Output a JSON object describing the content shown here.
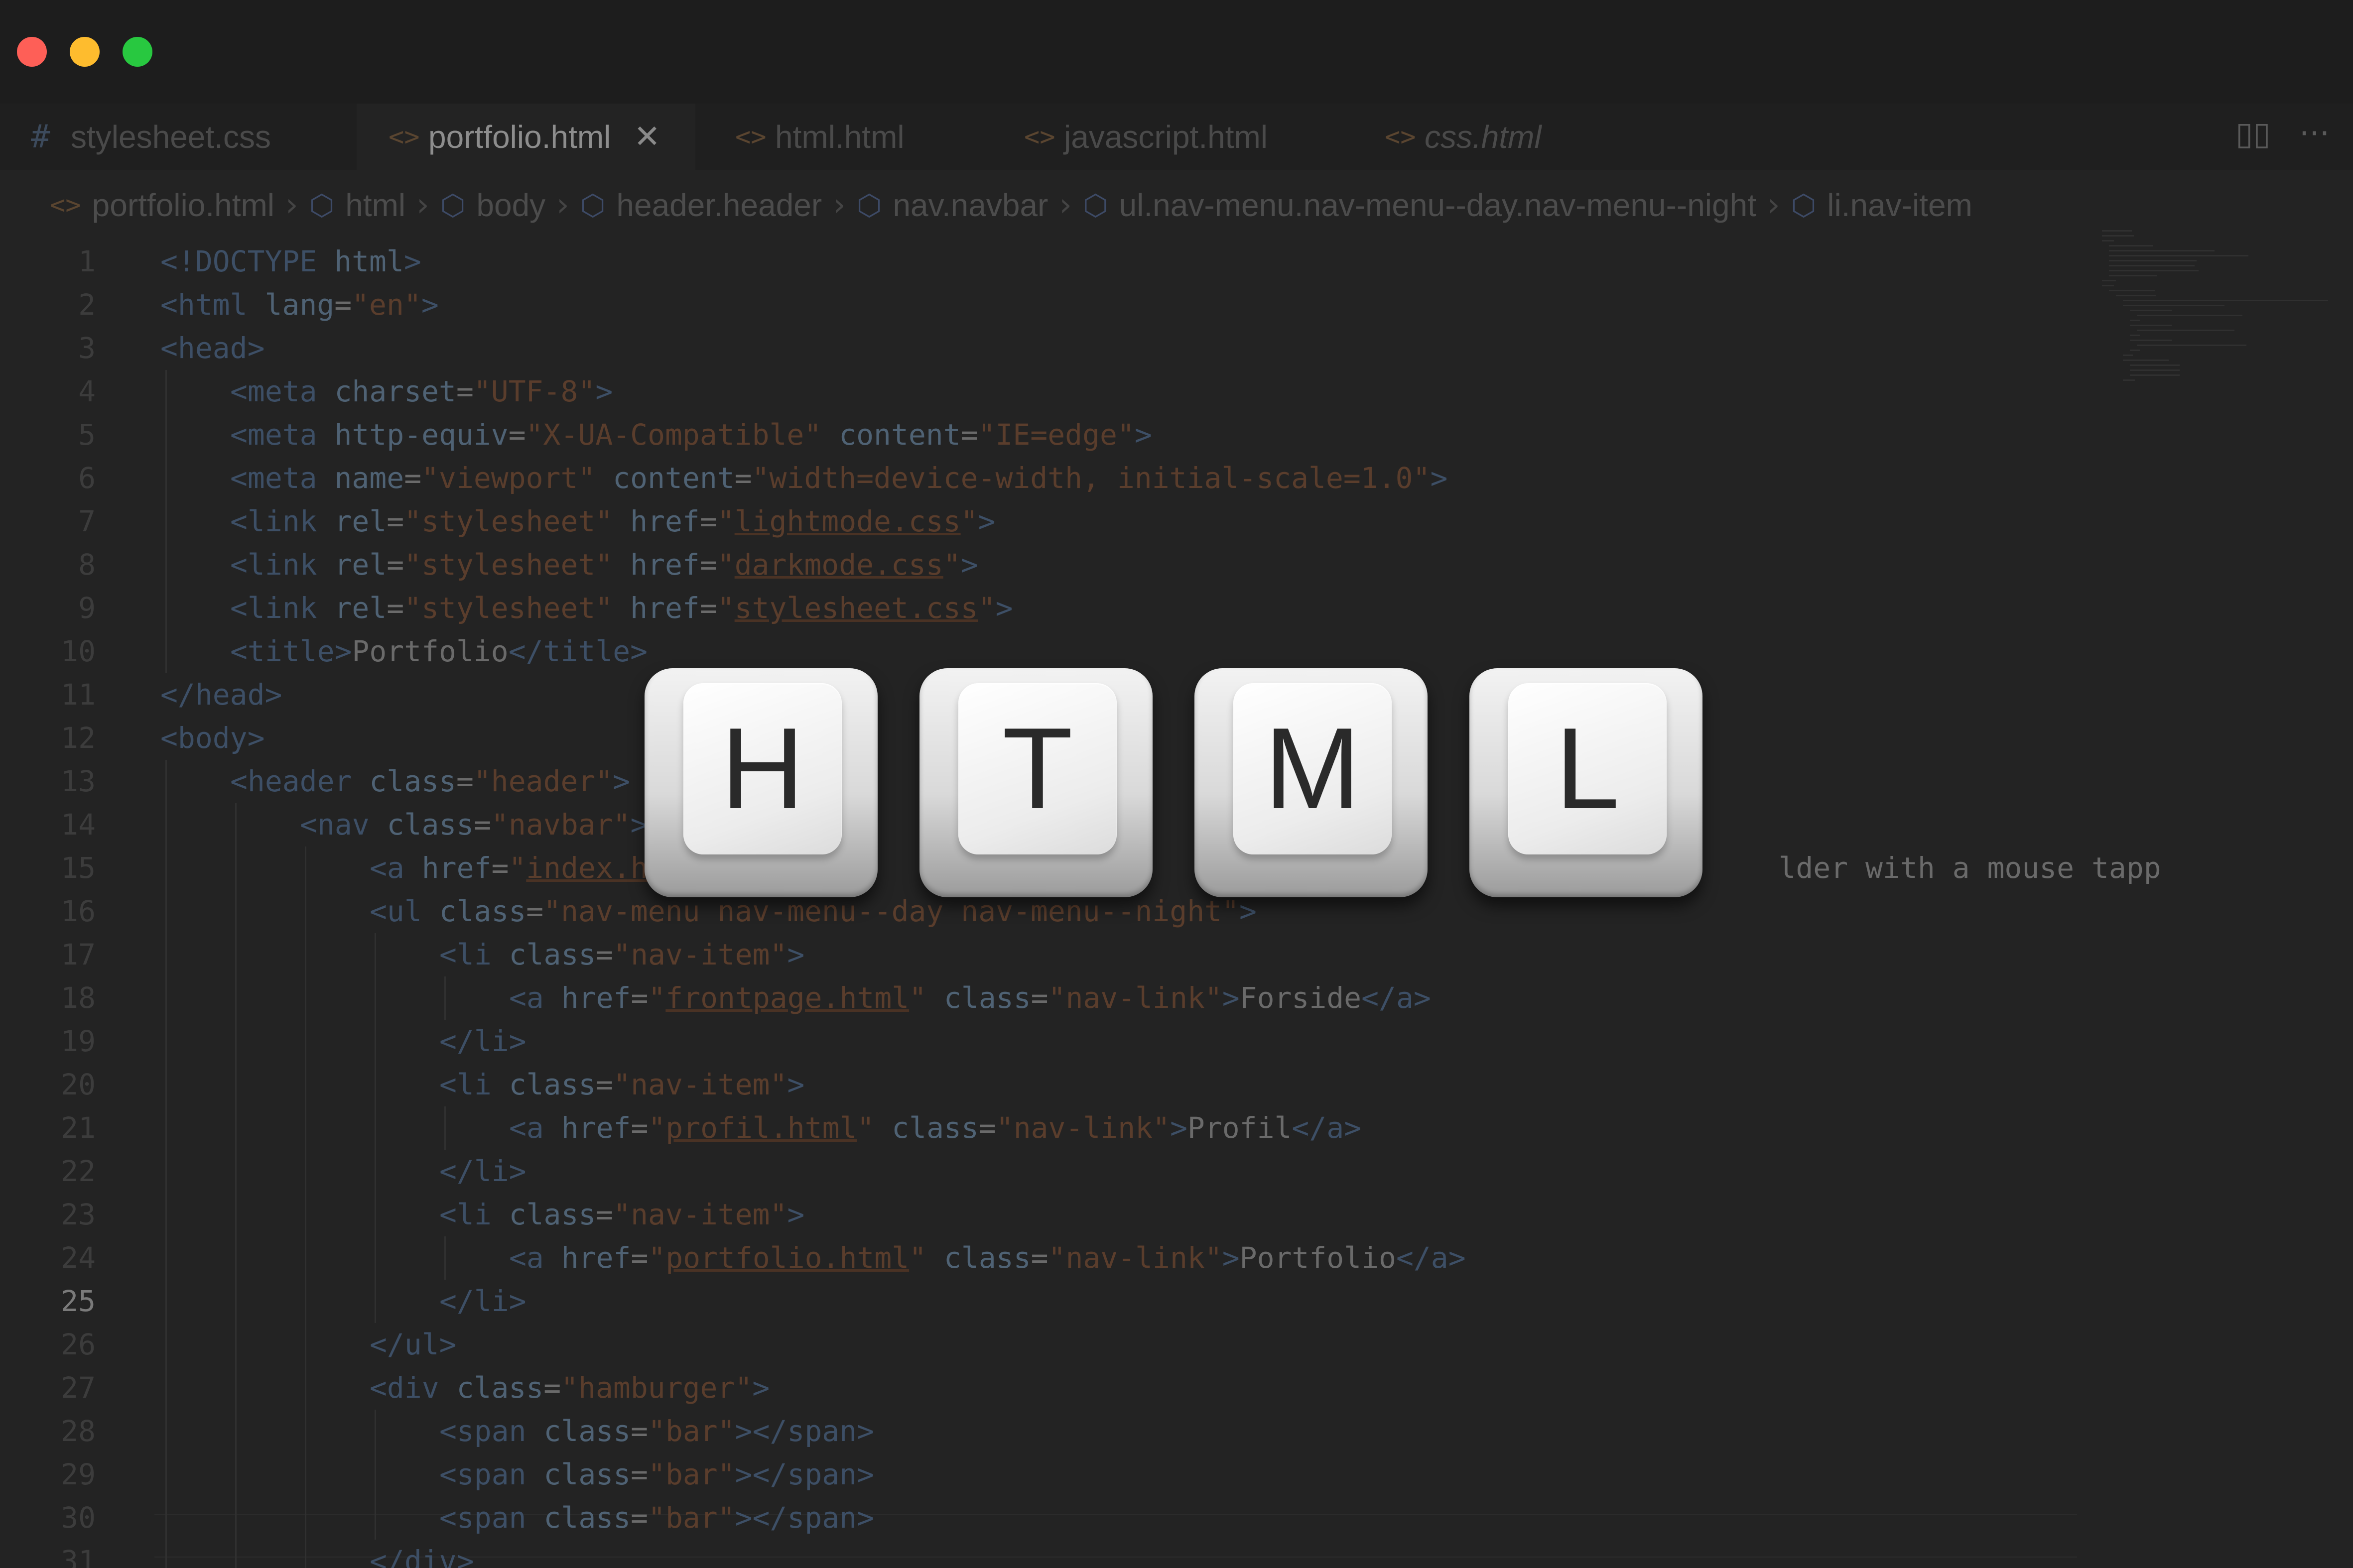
{
  "window": {
    "traffic_lights": [
      {
        "name": "close",
        "color": "#fe5f57"
      },
      {
        "name": "minimize",
        "color": "#febc2e"
      },
      {
        "name": "maximize",
        "color": "#28c840"
      }
    ]
  },
  "tabs": [
    {
      "label": "stylesheet.css",
      "icon": "hash-icon",
      "active": false
    },
    {
      "label": "portfolio.html",
      "icon": "code-icon",
      "active": true
    },
    {
      "label": "html.html",
      "icon": "code-icon",
      "active": false
    },
    {
      "label": "javascript.html",
      "icon": "code-icon",
      "active": false
    },
    {
      "label": "css.html",
      "icon": "code-icon",
      "active": false,
      "italic": true
    }
  ],
  "toolbar": {
    "split_icon": "split-editor-icon",
    "more_icon": "more-actions-icon"
  },
  "breadcrumb": [
    {
      "label": "portfolio.html",
      "icon": "code-icon"
    },
    {
      "label": "html",
      "icon": "cube-icon"
    },
    {
      "label": "body",
      "icon": "cube-icon"
    },
    {
      "label": "header.header",
      "icon": "cube-icon"
    },
    {
      "label": "nav.navbar",
      "icon": "cube-icon"
    },
    {
      "label": "ul.nav-menu.nav-menu--day.nav-menu--night",
      "icon": "cube-icon"
    },
    {
      "label": "li.nav-item",
      "icon": "cube-icon"
    }
  ],
  "editor": {
    "current_line": "25",
    "lines": [
      {
        "n": "1",
        "indent": 0,
        "segments": [
          {
            "t": "<!DOCTYPE ",
            "c": "tg"
          },
          {
            "t": "html",
            "c": "at"
          },
          {
            "t": ">",
            "c": "tg"
          }
        ]
      },
      {
        "n": "2",
        "indent": 0,
        "segments": [
          {
            "t": "<html ",
            "c": "tg"
          },
          {
            "t": "lang",
            "c": "at"
          },
          {
            "t": "=",
            "c": "tx"
          },
          {
            "t": "\"en\"",
            "c": "sv"
          },
          {
            "t": ">",
            "c": "tg"
          }
        ]
      },
      {
        "n": "3",
        "indent": 0,
        "segments": [
          {
            "t": "<head>",
            "c": "tg"
          }
        ]
      },
      {
        "n": "4",
        "indent": 1,
        "segments": [
          {
            "t": "<meta ",
            "c": "tg"
          },
          {
            "t": "charset",
            "c": "at"
          },
          {
            "t": "=",
            "c": "tx"
          },
          {
            "t": "\"UTF-8\"",
            "c": "sv"
          },
          {
            "t": ">",
            "c": "tg"
          }
        ]
      },
      {
        "n": "5",
        "indent": 1,
        "segments": [
          {
            "t": "<meta ",
            "c": "tg"
          },
          {
            "t": "http-equiv",
            "c": "at"
          },
          {
            "t": "=",
            "c": "tx"
          },
          {
            "t": "\"X-UA-Compatible\" ",
            "c": "sv"
          },
          {
            "t": "content",
            "c": "at"
          },
          {
            "t": "=",
            "c": "tx"
          },
          {
            "t": "\"IE=edge\"",
            "c": "sv"
          },
          {
            "t": ">",
            "c": "tg"
          }
        ]
      },
      {
        "n": "6",
        "indent": 1,
        "segments": [
          {
            "t": "<meta ",
            "c": "tg"
          },
          {
            "t": "name",
            "c": "at"
          },
          {
            "t": "=",
            "c": "tx"
          },
          {
            "t": "\"viewport\" ",
            "c": "sv"
          },
          {
            "t": "content",
            "c": "at"
          },
          {
            "t": "=",
            "c": "tx"
          },
          {
            "t": "\"width=device-width, initial-scale=1.0\"",
            "c": "sv"
          },
          {
            "t": ">",
            "c": "tg"
          }
        ]
      },
      {
        "n": "7",
        "indent": 1,
        "segments": [
          {
            "t": "<link ",
            "c": "tg"
          },
          {
            "t": "rel",
            "c": "at"
          },
          {
            "t": "=",
            "c": "tx"
          },
          {
            "t": "\"stylesheet\" ",
            "c": "sv"
          },
          {
            "t": "href",
            "c": "at"
          },
          {
            "t": "=",
            "c": "tx"
          },
          {
            "t": "\"",
            "c": "sv"
          },
          {
            "t": "lightmode.css",
            "c": "lk"
          },
          {
            "t": "\"",
            "c": "sv"
          },
          {
            "t": ">",
            "c": "tg"
          }
        ]
      },
      {
        "n": "8",
        "indent": 1,
        "segments": [
          {
            "t": "<link ",
            "c": "tg"
          },
          {
            "t": "rel",
            "c": "at"
          },
          {
            "t": "=",
            "c": "tx"
          },
          {
            "t": "\"stylesheet\" ",
            "c": "sv"
          },
          {
            "t": "href",
            "c": "at"
          },
          {
            "t": "=",
            "c": "tx"
          },
          {
            "t": "\"",
            "c": "sv"
          },
          {
            "t": "darkmode.css",
            "c": "lk"
          },
          {
            "t": "\"",
            "c": "sv"
          },
          {
            "t": ">",
            "c": "tg"
          }
        ]
      },
      {
        "n": "9",
        "indent": 1,
        "segments": [
          {
            "t": "<link ",
            "c": "tg"
          },
          {
            "t": "rel",
            "c": "at"
          },
          {
            "t": "=",
            "c": "tx"
          },
          {
            "t": "\"stylesheet\" ",
            "c": "sv"
          },
          {
            "t": "href",
            "c": "at"
          },
          {
            "t": "=",
            "c": "tx"
          },
          {
            "t": "\"",
            "c": "sv"
          },
          {
            "t": "stylesheet.css",
            "c": "lk"
          },
          {
            "t": "\"",
            "c": "sv"
          },
          {
            "t": ">",
            "c": "tg"
          }
        ]
      },
      {
        "n": "10",
        "indent": 1,
        "segments": [
          {
            "t": "<title>",
            "c": "tg"
          },
          {
            "t": "Portfolio",
            "c": "tx"
          },
          {
            "t": "</title>",
            "c": "tg"
          }
        ]
      },
      {
        "n": "11",
        "indent": 0,
        "segments": [
          {
            "t": "</head>",
            "c": "tg"
          }
        ]
      },
      {
        "n": "12",
        "indent": 0,
        "segments": [
          {
            "t": "<body>",
            "c": "tg"
          }
        ]
      },
      {
        "n": "13",
        "indent": 1,
        "segments": [
          {
            "t": "<header ",
            "c": "tg"
          },
          {
            "t": "class",
            "c": "at"
          },
          {
            "t": "=",
            "c": "tx"
          },
          {
            "t": "\"header\"",
            "c": "sv"
          },
          {
            "t": ">",
            "c": "tg"
          }
        ]
      },
      {
        "n": "14",
        "indent": 2,
        "segments": [
          {
            "t": "<nav ",
            "c": "tg"
          },
          {
            "t": "class",
            "c": "at"
          },
          {
            "t": "=",
            "c": "tx"
          },
          {
            "t": "\"navbar\"",
            "c": "sv"
          },
          {
            "t": ">",
            "c": "tg"
          }
        ]
      },
      {
        "n": "15",
        "indent": 3,
        "segments": [
          {
            "t": "<a ",
            "c": "tg"
          },
          {
            "t": "href",
            "c": "at"
          },
          {
            "t": "=",
            "c": "tx"
          },
          {
            "t": "\"",
            "c": "sv"
          },
          {
            "t": "index.h",
            "c": "lk"
          },
          {
            "t": "                                                                 lder with a mouse tapp",
            "c": "tx"
          }
        ]
      },
      {
        "n": "16",
        "indent": 3,
        "segments": [
          {
            "t": "<ul ",
            "c": "tg"
          },
          {
            "t": "class",
            "c": "at"
          },
          {
            "t": "=",
            "c": "tx"
          },
          {
            "t": "\"nav-menu nav-menu--day nav-menu--night\"",
            "c": "sv"
          },
          {
            "t": ">",
            "c": "tg"
          }
        ]
      },
      {
        "n": "17",
        "indent": 4,
        "segments": [
          {
            "t": "<li ",
            "c": "tg"
          },
          {
            "t": "class",
            "c": "at"
          },
          {
            "t": "=",
            "c": "tx"
          },
          {
            "t": "\"nav-item\"",
            "c": "sv"
          },
          {
            "t": ">",
            "c": "tg"
          }
        ]
      },
      {
        "n": "18",
        "indent": 5,
        "segments": [
          {
            "t": "<a ",
            "c": "tg"
          },
          {
            "t": "href",
            "c": "at"
          },
          {
            "t": "=",
            "c": "tx"
          },
          {
            "t": "\"",
            "c": "sv"
          },
          {
            "t": "frontpage.html",
            "c": "lk"
          },
          {
            "t": "\" ",
            "c": "sv"
          },
          {
            "t": "class",
            "c": "at"
          },
          {
            "t": "=",
            "c": "tx"
          },
          {
            "t": "\"nav-link\"",
            "c": "sv"
          },
          {
            "t": ">",
            "c": "tg"
          },
          {
            "t": "Forside",
            "c": "tx"
          },
          {
            "t": "</a>",
            "c": "tg"
          }
        ]
      },
      {
        "n": "19",
        "indent": 4,
        "segments": [
          {
            "t": "</li>",
            "c": "tg"
          }
        ]
      },
      {
        "n": "20",
        "indent": 4,
        "segments": [
          {
            "t": "<li ",
            "c": "tg"
          },
          {
            "t": "class",
            "c": "at"
          },
          {
            "t": "=",
            "c": "tx"
          },
          {
            "t": "\"nav-item\"",
            "c": "sv"
          },
          {
            "t": ">",
            "c": "tg"
          }
        ]
      },
      {
        "n": "21",
        "indent": 5,
        "segments": [
          {
            "t": "<a ",
            "c": "tg"
          },
          {
            "t": "href",
            "c": "at"
          },
          {
            "t": "=",
            "c": "tx"
          },
          {
            "t": "\"",
            "c": "sv"
          },
          {
            "t": "profil.html",
            "c": "lk"
          },
          {
            "t": "\" ",
            "c": "sv"
          },
          {
            "t": "class",
            "c": "at"
          },
          {
            "t": "=",
            "c": "tx"
          },
          {
            "t": "\"nav-link\"",
            "c": "sv"
          },
          {
            "t": ">",
            "c": "tg"
          },
          {
            "t": "Profil",
            "c": "tx"
          },
          {
            "t": "</a>",
            "c": "tg"
          }
        ]
      },
      {
        "n": "22",
        "indent": 4,
        "segments": [
          {
            "t": "</li>",
            "c": "tg"
          }
        ]
      },
      {
        "n": "23",
        "indent": 4,
        "segments": [
          {
            "t": "<li ",
            "c": "tg"
          },
          {
            "t": "class",
            "c": "at"
          },
          {
            "t": "=",
            "c": "tx"
          },
          {
            "t": "\"nav-item\"",
            "c": "sv"
          },
          {
            "t": ">",
            "c": "tg"
          }
        ]
      },
      {
        "n": "24",
        "indent": 5,
        "segments": [
          {
            "t": "<a ",
            "c": "tg"
          },
          {
            "t": "href",
            "c": "at"
          },
          {
            "t": "=",
            "c": "tx"
          },
          {
            "t": "\"",
            "c": "sv"
          },
          {
            "t": "portfolio.html",
            "c": "lk"
          },
          {
            "t": "\" ",
            "c": "sv"
          },
          {
            "t": "class",
            "c": "at"
          },
          {
            "t": "=",
            "c": "tx"
          },
          {
            "t": "\"nav-link\"",
            "c": "sv"
          },
          {
            "t": ">",
            "c": "tg"
          },
          {
            "t": "Portfolio",
            "c": "tx"
          },
          {
            "t": "</a>",
            "c": "tg"
          }
        ]
      },
      {
        "n": "25",
        "indent": 4,
        "segments": [
          {
            "t": "</li>",
            "c": "tg"
          }
        ]
      },
      {
        "n": "26",
        "indent": 3,
        "segments": [
          {
            "t": "</ul>",
            "c": "tg"
          }
        ]
      },
      {
        "n": "27",
        "indent": 3,
        "segments": [
          {
            "t": "<div ",
            "c": "tg"
          },
          {
            "t": "class",
            "c": "at"
          },
          {
            "t": "=",
            "c": "tx"
          },
          {
            "t": "\"hamburger\"",
            "c": "sv"
          },
          {
            "t": ">",
            "c": "tg"
          }
        ]
      },
      {
        "n": "28",
        "indent": 4,
        "segments": [
          {
            "t": "<span ",
            "c": "tg"
          },
          {
            "t": "class",
            "c": "at"
          },
          {
            "t": "=",
            "c": "tx"
          },
          {
            "t": "\"bar\"",
            "c": "sv"
          },
          {
            "t": "></span>",
            "c": "tg"
          }
        ]
      },
      {
        "n": "29",
        "indent": 4,
        "segments": [
          {
            "t": "<span ",
            "c": "tg"
          },
          {
            "t": "class",
            "c": "at"
          },
          {
            "t": "=",
            "c": "tx"
          },
          {
            "t": "\"bar\"",
            "c": "sv"
          },
          {
            "t": "></span>",
            "c": "tg"
          }
        ]
      },
      {
        "n": "30",
        "indent": 4,
        "segments": [
          {
            "t": "<span ",
            "c": "tg"
          },
          {
            "t": "class",
            "c": "at"
          },
          {
            "t": "=",
            "c": "tx"
          },
          {
            "t": "\"bar\"",
            "c": "sv"
          },
          {
            "t": "></span>",
            "c": "tg"
          }
        ]
      },
      {
        "n": "31",
        "indent": 3,
        "segments": [
          {
            "t": "</div>",
            "c": "tg"
          }
        ]
      }
    ]
  },
  "keycaps": [
    "H",
    "T",
    "M",
    "L"
  ]
}
